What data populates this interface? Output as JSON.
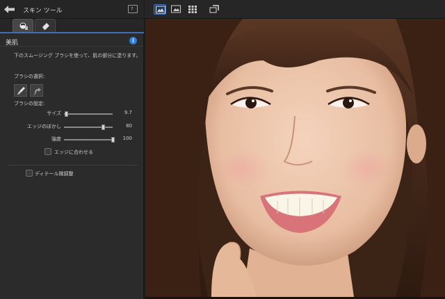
{
  "panel": {
    "title": "スキン ツール",
    "help_label": "?",
    "tabs": [
      {
        "name": "skin-smoothing",
        "icon": "face-brush-icon",
        "active": true
      },
      {
        "name": "eraser",
        "icon": "eraser-icon",
        "active": false
      }
    ],
    "section_title": "美肌",
    "info_label": "i",
    "description": "下のスムージング ブラシを使って、肌の部分に塗ります。",
    "brush_select_label": "ブラシの選択:",
    "brush_settings_label": "ブラシの設定:",
    "sliders": [
      {
        "label": "サイズ",
        "value": "9.7",
        "fraction": 0.04
      },
      {
        "label": "エッジのぼかし",
        "value": "80",
        "fraction": 0.8
      },
      {
        "label": "強度",
        "value": "100",
        "fraction": 1.0
      }
    ],
    "fit_edges_label": "エッジに合わせる",
    "fit_edges_checked": false,
    "detail_adjust_label": "ディテール微調整",
    "detail_adjust_checked": false
  },
  "toolbar": {
    "buttons": [
      "compare-split-icon",
      "single-view-icon",
      "grid-view-icon",
      "fit-screen-icon"
    ],
    "accent": "#3d72bc"
  },
  "image": {
    "subject": "smiling-woman-portrait"
  }
}
